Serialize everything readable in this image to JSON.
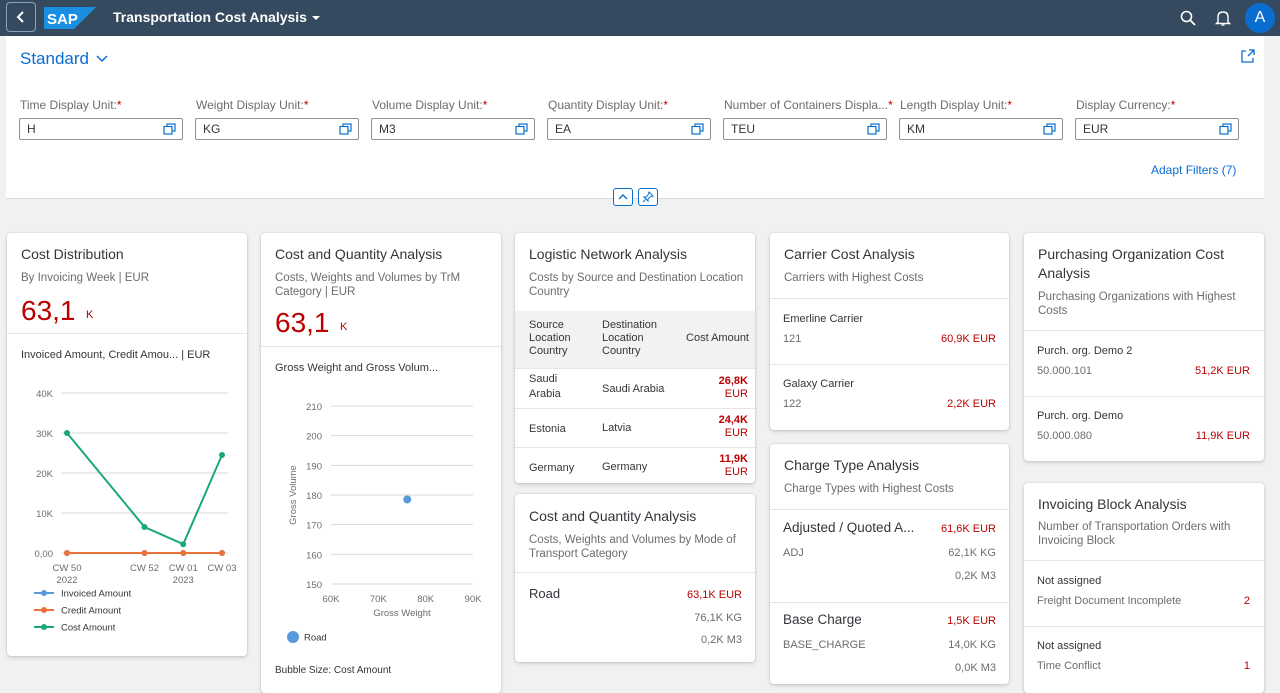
{
  "shell": {
    "app_title": "Transportation Cost Analysis",
    "avatar": "A"
  },
  "filter_bar": {
    "variant": "Standard",
    "fields": [
      {
        "label": "Time Display Unit:",
        "value": "H"
      },
      {
        "label": "Weight Display Unit:",
        "value": "KG"
      },
      {
        "label": "Volume Display Unit:",
        "value": "M3"
      },
      {
        "label": "Quantity Display Unit:",
        "value": "EA"
      },
      {
        "label": "Number of Containers Displa...",
        "value": "TEU"
      },
      {
        "label": "Length Display Unit:",
        "value": "KM"
      },
      {
        "label": "Display Currency:",
        "value": "EUR"
      }
    ],
    "required_mark": "*",
    "adapt_filters": "Adapt Filters (7)"
  },
  "cards": {
    "cost_distribution": {
      "title": "Cost Distribution",
      "subtitle": "By Invoicing Week | EUR",
      "kpi": "63,1",
      "kpi_unit": "K",
      "chart_title": "Invoiced Amount, Credit Amou... | EUR"
    },
    "cost_quantity_trm": {
      "title": "Cost and Quantity Analysis",
      "subtitle": "Costs, Weights and Volumes by TrM Category | EUR",
      "kpi": "63,1",
      "kpi_unit": "K",
      "chart_title": "Gross Weight and Gross Volum...",
      "bubble_size": "Bubble Size: Cost Amount"
    },
    "logistic_network": {
      "title": "Logistic Network Analysis",
      "subtitle": "Costs by Source and Destination Location Country",
      "columns": [
        "Source Location Country",
        "Destination Location Country",
        "Cost Amount"
      ],
      "rows": [
        {
          "source": "Saudi Arabia",
          "dest": "Saudi Arabia",
          "amount": "26,8K",
          "currency": "EUR"
        },
        {
          "source": "Estonia",
          "dest": "Latvia",
          "amount": "24,4K",
          "currency": "EUR"
        },
        {
          "source": "Germany",
          "dest": "Germany",
          "amount": "11,9K",
          "currency": "EUR"
        }
      ]
    },
    "cost_quantity_mode": {
      "title": "Cost and Quantity Analysis",
      "subtitle": "Costs, Weights and Volumes by Mode of Transport Category",
      "item": {
        "name": "Road",
        "cost": "63,1K EUR",
        "weight": "76,1K KG",
        "volume": "0,2K M3"
      }
    },
    "carrier_cost": {
      "title": "Carrier Cost Analysis",
      "subtitle": "Carriers with Highest Costs",
      "items": [
        {
          "name": "Emerline Carrier",
          "id": "121",
          "amount": "60,9K EUR"
        },
        {
          "name": "Galaxy Carrier",
          "id": "122",
          "amount": "2,2K EUR"
        }
      ]
    },
    "charge_type": {
      "title": "Charge Type Analysis",
      "subtitle": "Charge Types with Highest Costs",
      "items": [
        {
          "name": "Adjusted / Quoted A...",
          "code": "ADJ",
          "amount": "61,6K EUR",
          "weight": "62,1K KG",
          "volume": "0,2K M3"
        },
        {
          "name": "Base Charge",
          "code": "BASE_CHARGE",
          "amount": "1,5K EUR",
          "weight": "14,0K KG",
          "volume": "0,0K M3"
        }
      ]
    },
    "purch_org": {
      "title": "Purchasing Organization Cost Analysis",
      "subtitle": "Purchasing Organizations with Highest Costs",
      "items": [
        {
          "name": "Purch. org. Demo 2",
          "id": "50.000.101",
          "amount": "51,2K EUR"
        },
        {
          "name": "Purch. org. Demo",
          "id": "50.000.080",
          "amount": "11,9K EUR"
        }
      ]
    },
    "invoicing_block": {
      "title": "Invoicing Block Analysis",
      "subtitle": "Number of Transportation Orders with Invoicing Block",
      "items": [
        {
          "name": "Not assigned",
          "reason": "Freight Document Incomplete",
          "count": "2"
        },
        {
          "name": "Not assigned",
          "reason": "Time Conflict",
          "count": "1"
        }
      ]
    }
  },
  "chart_data": [
    {
      "type": "line",
      "title": "Invoiced Amount, Credit Amou... | EUR",
      "categories": [
        "CW 50 2022",
        "CW 52",
        "CW 01 2023",
        "CW 03"
      ],
      "x_tick_labels": [
        [
          "CW 50",
          "2022"
        ],
        [
          "CW 52",
          ""
        ],
        [
          "CW 01",
          "2023"
        ],
        [
          "CW 03",
          ""
        ]
      ],
      "x_positions": [
        0,
        2,
        3,
        4
      ],
      "y_ticks": [
        "40K",
        "30K",
        "20K",
        "10K",
        "0,00"
      ],
      "ylim": [
        0,
        40000
      ],
      "grid": true,
      "legend_position": "bottom",
      "series": [
        {
          "name": "Invoiced Amount",
          "color": "#5899da",
          "values": [
            0,
            0,
            0,
            0
          ]
        },
        {
          "name": "Credit Amount",
          "color": "#e8743b",
          "values": [
            0,
            0,
            0,
            0
          ]
        },
        {
          "name": "Cost Amount",
          "color": "#19a979",
          "values": [
            30000,
            6500,
            2200,
            24500
          ]
        }
      ]
    },
    {
      "type": "scatter",
      "title": "Gross Weight and Gross Volum...",
      "xlabel": "Gross Weight",
      "ylabel": "Gross Volume",
      "x_ticks": [
        "60K",
        "70K",
        "80K",
        "90K"
      ],
      "y_ticks": [
        "210",
        "200",
        "190",
        "180",
        "170",
        "160",
        "150"
      ],
      "xlim": [
        60000,
        90000
      ],
      "ylim": [
        150,
        210
      ],
      "grid": true,
      "legend_position": "bottom",
      "series": [
        {
          "name": "Road",
          "color": "#5899da",
          "points": [
            {
              "x": 76100,
              "y": 178.5
            }
          ]
        }
      ]
    }
  ]
}
